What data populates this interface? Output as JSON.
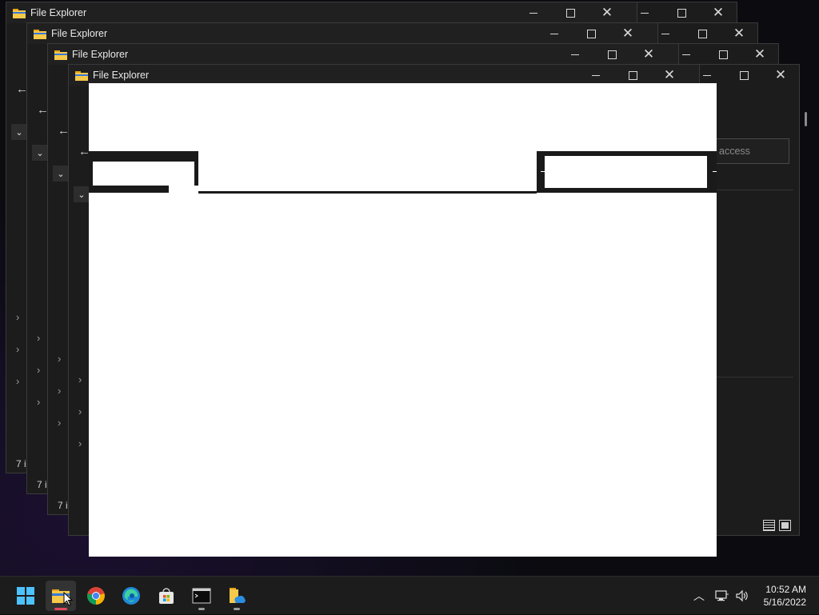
{
  "window": {
    "app_title": "File Explorer",
    "controls": {
      "minimize": "minimize",
      "maximize": "maximize",
      "close": "close"
    }
  },
  "back_window": {
    "status_count_prefix": "7 i",
    "search_placeholder_fragment": "access"
  },
  "taskbar": {
    "apps": [
      {
        "name": "start-icon"
      },
      {
        "name": "file-explorer-icon"
      },
      {
        "name": "chrome-icon"
      },
      {
        "name": "edge-icon"
      },
      {
        "name": "store-icon"
      },
      {
        "name": "terminal-icon"
      },
      {
        "name": "onedrive-folder-icon"
      }
    ],
    "tray": {
      "time": "10:52 AM",
      "date": "5/16/2022"
    }
  },
  "colors": {
    "accent_blue": "#4cc2ff",
    "active_indicator": "#e04a5f",
    "window_bg": "#1c1c1c"
  }
}
